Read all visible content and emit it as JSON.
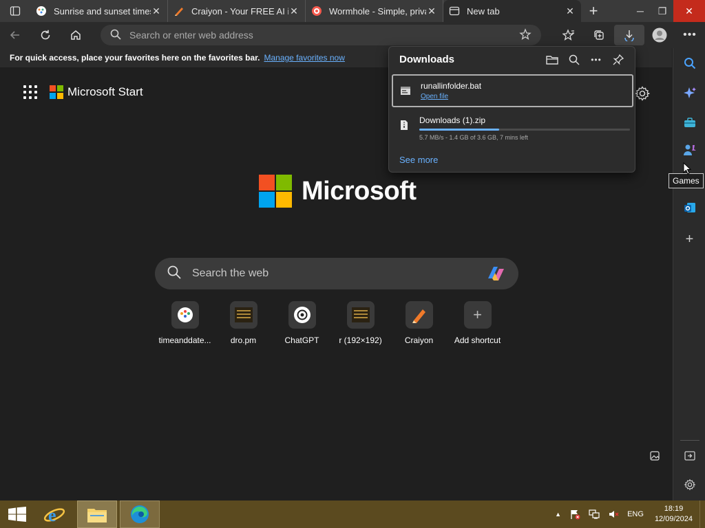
{
  "tabs": [
    {
      "title": "Sunrise and sunset times",
      "favicon": "timeanddate-icon",
      "active": false
    },
    {
      "title": "Craiyon - Your FREE AI image generator",
      "favicon": "craiyon-icon",
      "active": false
    },
    {
      "title": "Wormhole - Simple, private file sharing",
      "favicon": "wormhole-icon",
      "active": false
    },
    {
      "title": "New tab",
      "favicon": "newtab-icon",
      "active": true
    }
  ],
  "toolbar": {
    "address_placeholder": "Search or enter web address"
  },
  "favbar": {
    "text": "For quick access, place your favorites here on the favorites bar.",
    "link": "Manage favorites now"
  },
  "content": {
    "start_label": "Microsoft Start",
    "brand": "Microsoft",
    "search_placeholder": "Search the web",
    "shortcuts": [
      {
        "label": "timeanddate...",
        "icon": "timeanddate-icon"
      },
      {
        "label": "dro.pm",
        "icon": "dro-pm-icon"
      },
      {
        "label": "ChatGPT",
        "icon": "chatgpt-icon"
      },
      {
        "label": "r (192×192)",
        "icon": "r-thumbnail-icon"
      },
      {
        "label": "Craiyon",
        "icon": "craiyon-icon"
      },
      {
        "label": "Add shortcut",
        "icon": "plus-icon"
      }
    ]
  },
  "downloads": {
    "title": "Downloads",
    "items": [
      {
        "name": "runallinfolder.bat",
        "action": "Open file"
      },
      {
        "name": "Downloads (1).zip",
        "status": "5.7 MB/s - 1.4 GB of 3.6 GB, 7 mins left",
        "progress": 0.38
      }
    ],
    "see_more": "See more"
  },
  "sidebar": {
    "tooltip": "Games"
  },
  "taskbar": {
    "language": "ENG",
    "time": "18:19",
    "date": "12/09/2024"
  },
  "colors": {
    "accent": "#6ab2ff",
    "taskbar": "#5b4a1f",
    "close": "#c42b1c"
  }
}
